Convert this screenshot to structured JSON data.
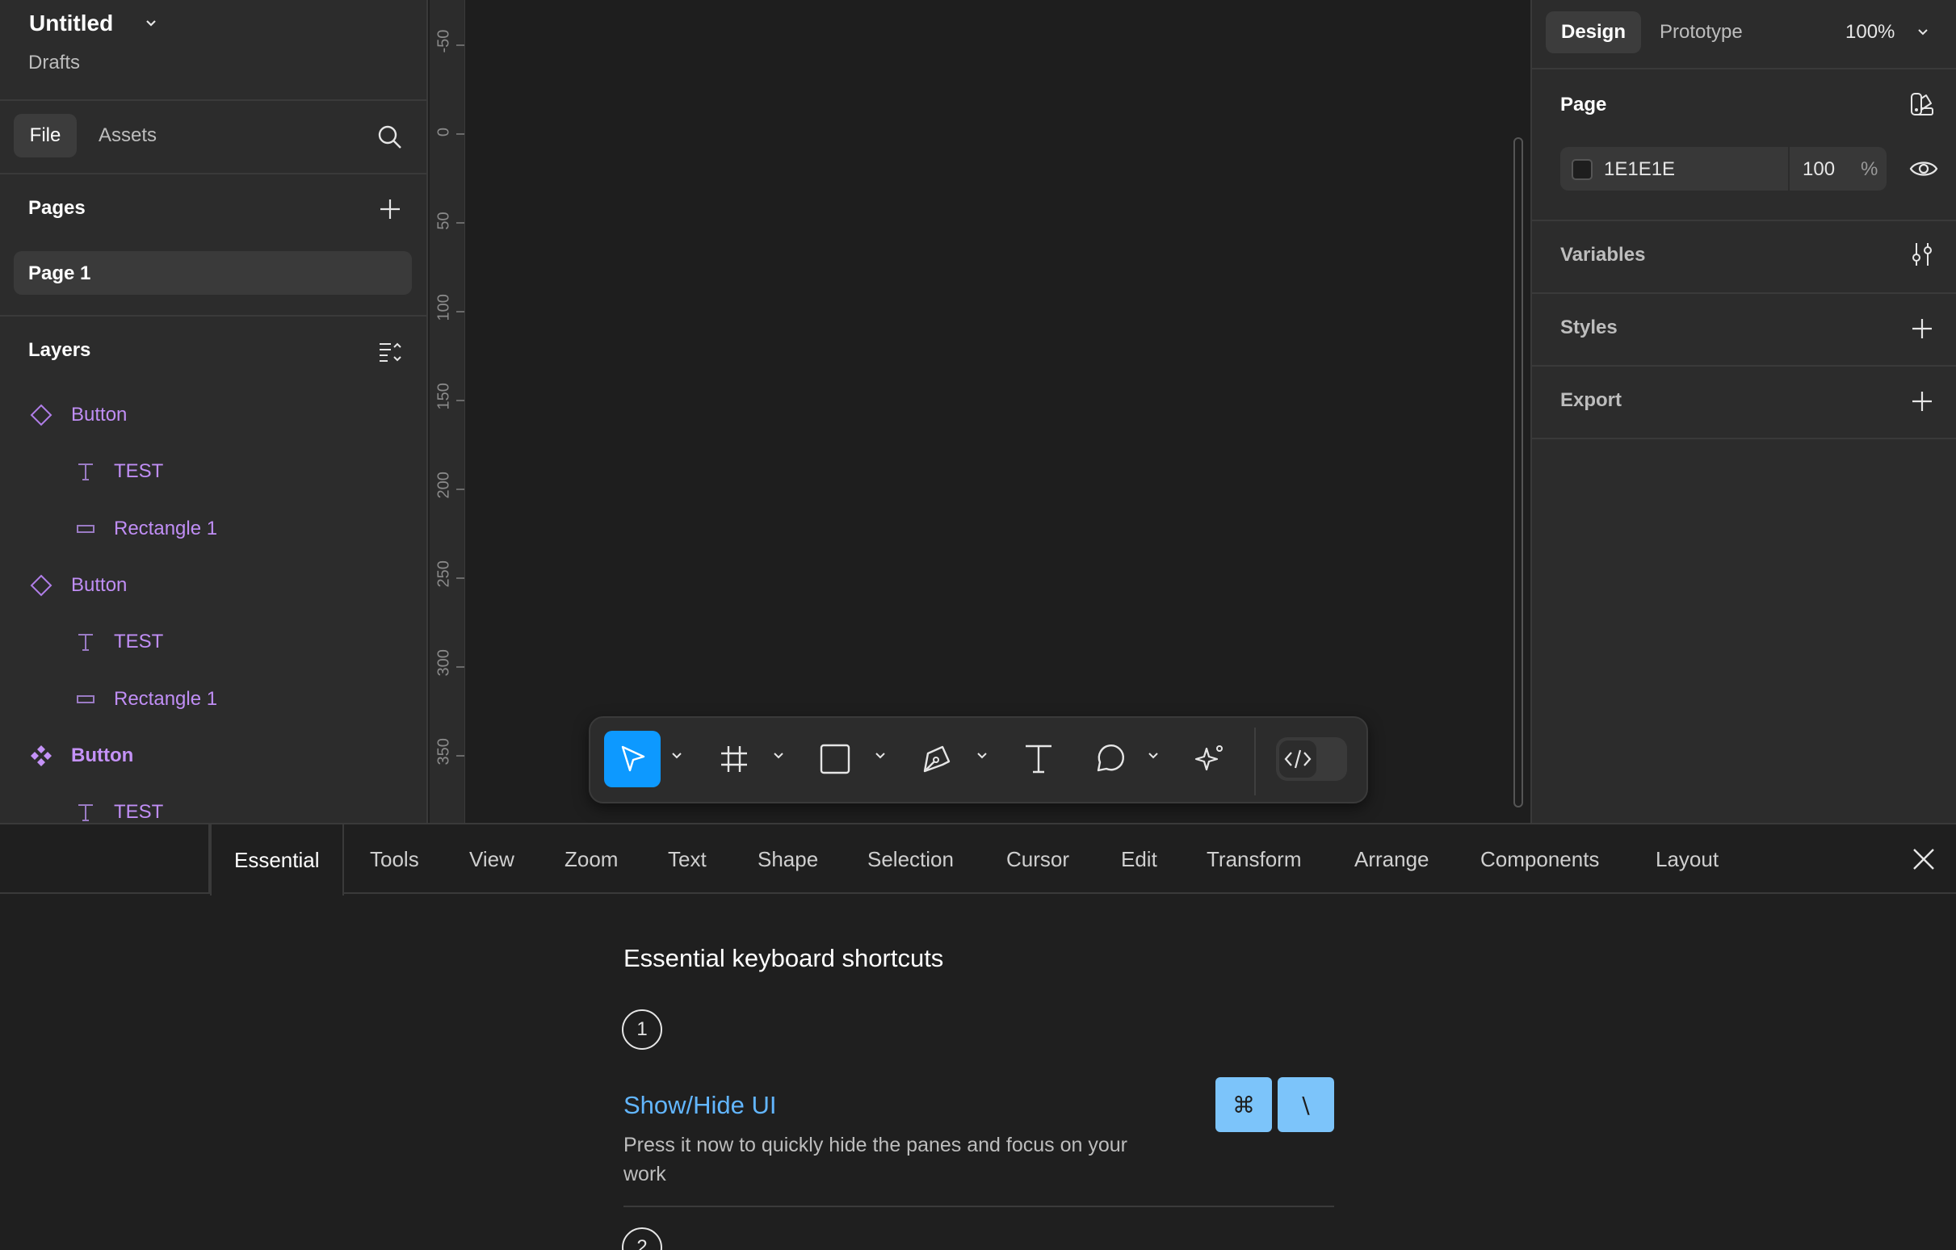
{
  "file": {
    "title": "Untitled",
    "location": "Drafts"
  },
  "left_tabs": {
    "file": "File",
    "assets": "Assets"
  },
  "pages": {
    "heading": "Pages",
    "items": [
      {
        "label": "Page 1"
      }
    ]
  },
  "layers": {
    "heading": "Layers",
    "items": [
      {
        "label": "Button",
        "kind": "component-instance-icon",
        "indent": 0
      },
      {
        "label": "TEST",
        "kind": "text-icon",
        "indent": 1
      },
      {
        "label": "Rectangle 1",
        "kind": "rectangle-icon",
        "indent": 1
      },
      {
        "label": "Button",
        "kind": "component-instance-icon",
        "indent": 0
      },
      {
        "label": "TEST",
        "kind": "text-icon",
        "indent": 1
      },
      {
        "label": "Rectangle 1",
        "kind": "rectangle-icon",
        "indent": 1
      },
      {
        "label": "Button",
        "kind": "main-component-icon",
        "indent": 0
      },
      {
        "label": "TEST",
        "kind": "text-icon",
        "indent": 1
      }
    ]
  },
  "ruler": {
    "labels": [
      "-50",
      "0",
      "50",
      "100",
      "150",
      "200",
      "250",
      "300",
      "350"
    ]
  },
  "toolbar": {
    "tools": [
      {
        "name": "move-tool",
        "icon": "cursor-arrow-icon",
        "active": true
      },
      {
        "name": "frame-tool",
        "icon": "frame-hash-icon",
        "active": false
      },
      {
        "name": "shape-tool",
        "icon": "rectangle-icon",
        "active": false
      },
      {
        "name": "pen-tool",
        "icon": "pen-nib-icon",
        "active": false
      },
      {
        "name": "text-tool",
        "icon": "text-t-icon",
        "active": false
      },
      {
        "name": "comment-tool",
        "icon": "speech-bubble-icon",
        "active": false
      },
      {
        "name": "actions-tool",
        "icon": "sparkle-icon",
        "active": false
      }
    ],
    "dev_mode_icon": "code-brackets-icon"
  },
  "right_panel": {
    "tabs": {
      "design": "Design",
      "prototype": "Prototype"
    },
    "zoom": "100%",
    "page_section": {
      "title": "Page",
      "background_hex": "1E1E1E",
      "background_opacity": "100",
      "percent_sign": "%"
    },
    "variables": "Variables",
    "styles": "Styles",
    "export": "Export"
  },
  "shortcut_panel": {
    "tabs": [
      "Essential",
      "Tools",
      "View",
      "Zoom",
      "Text",
      "Shape",
      "Selection",
      "Cursor",
      "Edit",
      "Transform",
      "Arrange",
      "Components",
      "Layout"
    ],
    "active_tab": "Essential",
    "heading": "Essential keyboard shortcuts",
    "shortcuts": [
      {
        "number": "1",
        "title": "Show/Hide UI",
        "description": "Press it now to quickly hide the panes and focus on your work",
        "keys": [
          "⌘",
          "\\"
        ]
      },
      {
        "number": "2"
      }
    ]
  },
  "colors": {
    "accent": "#0d99ff",
    "layer_purple": "#c08ef5",
    "link_blue": "#62b6ff",
    "keycap": "#7cc4fa",
    "canvas_bg": "#1e1e1e",
    "panel_bg": "#2c2c2c"
  }
}
